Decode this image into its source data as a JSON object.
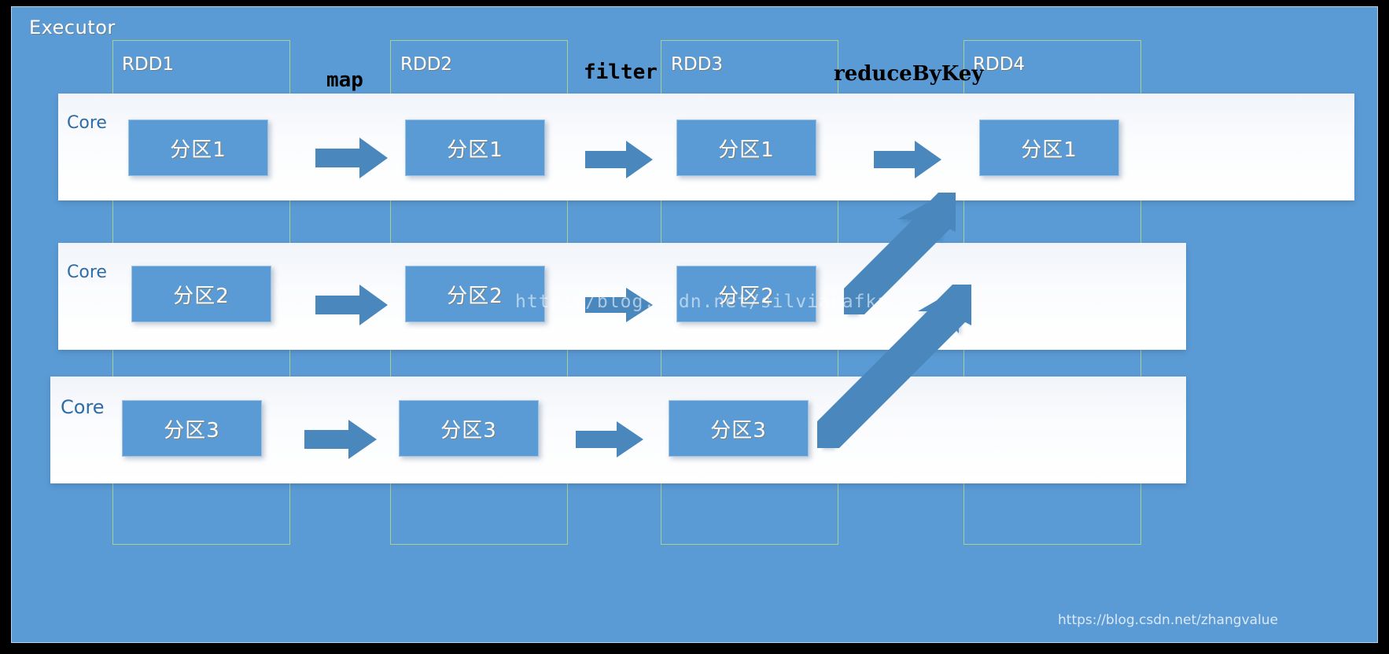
{
  "diagram": {
    "title": "Executor",
    "core_label": "Core",
    "rdds": [
      {
        "name": "RDD1",
        "partitions": [
          "分区1",
          "分区2",
          "分区3"
        ]
      },
      {
        "name": "RDD2",
        "partitions": [
          "分区1",
          "分区2",
          "分区3"
        ]
      },
      {
        "name": "RDD3",
        "partitions": [
          "分区1",
          "分区2",
          "分区3"
        ]
      },
      {
        "name": "RDD4",
        "partitions": [
          "分区1"
        ]
      }
    ],
    "operations": [
      {
        "label": "map"
      },
      {
        "label": "filter"
      },
      {
        "label": "reduceByKey"
      }
    ],
    "cores": [
      "Core",
      "Core",
      "Core"
    ],
    "watermarks": {
      "center": "http://blog.csdn.net/silviakafka",
      "corner": "https://blog.csdn.net/zhangvalue"
    },
    "colors": {
      "panel_blue": "#5b9bd5",
      "rdd_frame_green": "#a9d18e",
      "band_white": "#ffffff",
      "core_text_blue": "#2e6ca6",
      "arrow_blue": "#4a87bd",
      "text_white": "#ffffff",
      "op_text": "#000000"
    }
  }
}
